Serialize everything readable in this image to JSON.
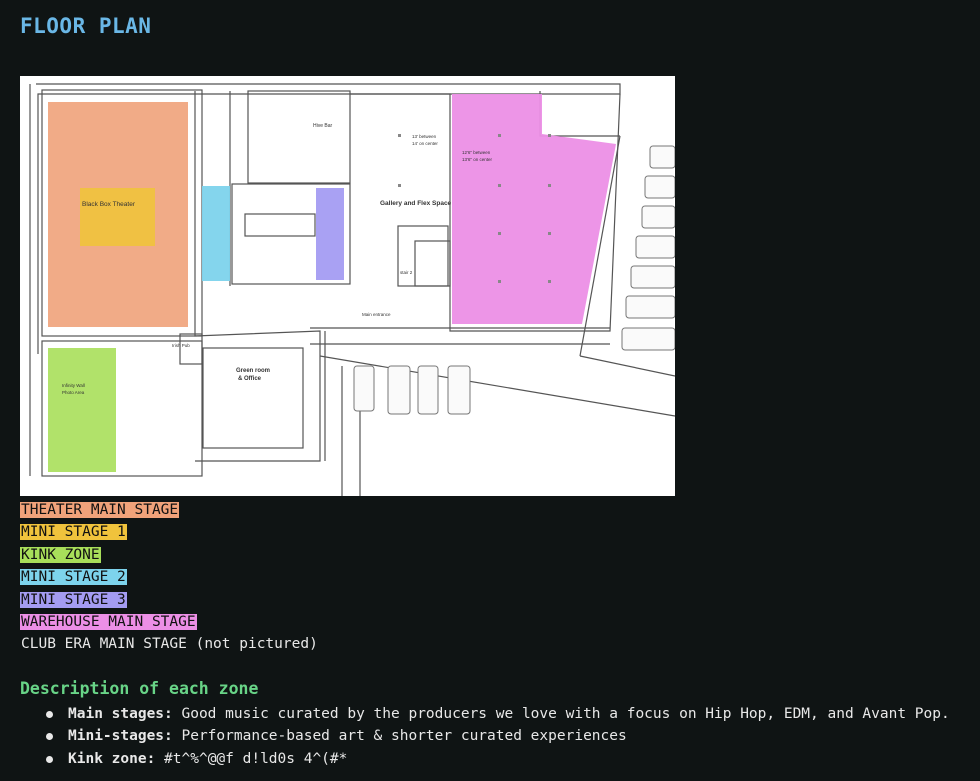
{
  "title": "FLOOR PLAN",
  "plan": {
    "labels": {
      "black_box": "Black Box Theater",
      "hive_bar": "Hive Bar",
      "gallery": "Gallery and Flex Space",
      "spacing_a1": "13' between",
      "spacing_a2": "14' on center",
      "spacing_b1": "12'6\" between",
      "spacing_b2": "13'6\" on center",
      "stair": "stair 2",
      "main_entrance": "Main entrance",
      "irish_pub": "Irish Pub",
      "green_room1": "Green room",
      "green_room2": "& Office",
      "infinity1": "Infinity Wall",
      "infinity2": "Photo Area"
    }
  },
  "zones": [
    {
      "label": "THEATER MAIN STAGE",
      "color": "#f0a27a"
    },
    {
      "label": "MINI STAGE 1",
      "color": "#f0c33c"
    },
    {
      "label": "KINK ZONE",
      "color": "#a8df5a"
    },
    {
      "label": "MINI STAGE 2",
      "color": "#7dd3ec"
    },
    {
      "label": "MINI STAGE 3",
      "color": "#a49cf2"
    },
    {
      "label": "WAREHOUSE MAIN STAGE",
      "color": "#ec8fe6"
    },
    {
      "label": "CLUB ERA MAIN STAGE (not pictured)",
      "color": ""
    }
  ],
  "description": {
    "heading": "Description of each zone",
    "items": [
      {
        "term": "Main stages:",
        "text": " Good music curated by the producers we love with a focus on Hip Hop, EDM, and Avant Pop."
      },
      {
        "term": "Mini-stages:",
        "text": " Performance-based art & shorter curated experiences"
      },
      {
        "term": "Kink zone:",
        "text": " #t^%^@@f d!ld0s 4^(#*"
      }
    ]
  }
}
